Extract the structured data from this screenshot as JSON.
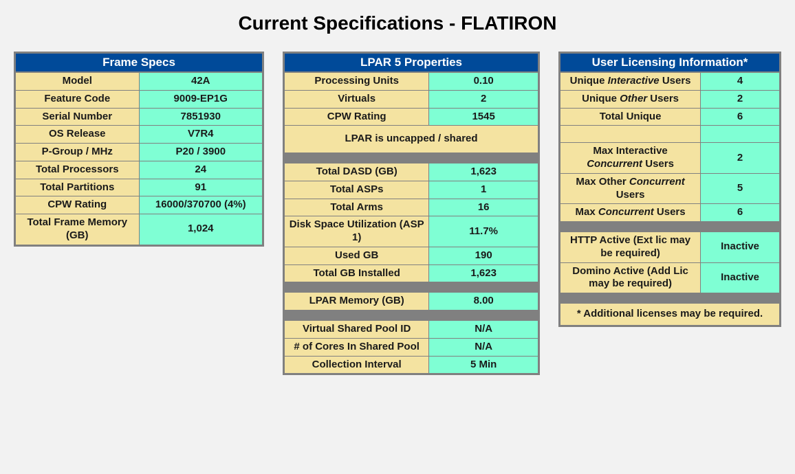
{
  "title": "Current Specifications - FLATIRON",
  "frame": {
    "header": "Frame Specs",
    "rows": [
      {
        "label": "Model",
        "value": "42A"
      },
      {
        "label": "Feature Code",
        "value": "9009-EP1G"
      },
      {
        "label": "Serial Number",
        "value": "7851930"
      },
      {
        "label": "OS Release",
        "value": "V7R4"
      },
      {
        "label": "P-Group / MHz",
        "value": "P20 / 3900"
      },
      {
        "label": "Total Processors",
        "value": "24"
      },
      {
        "label": "Total Partitions",
        "value": "91"
      },
      {
        "label": "CPW Rating",
        "value": "16000/370700 (4%)"
      },
      {
        "label": "Total Frame Memory (GB)",
        "value": "1,024"
      }
    ]
  },
  "lpar": {
    "header": "LPAR 5 Properties",
    "top": [
      {
        "label": "Processing Units",
        "value": "0.10"
      },
      {
        "label": "Virtuals",
        "value": "2"
      },
      {
        "label": "CPW Rating",
        "value": "1545"
      }
    ],
    "note": "LPAR is uncapped / shared",
    "dasd": [
      {
        "label": "Total DASD (GB)",
        "value": "1,623"
      },
      {
        "label": "Total ASPs",
        "value": "1"
      },
      {
        "label": "Total Arms",
        "value": "16"
      },
      {
        "label": "Disk Space Utilization (ASP 1)",
        "value": "11.7%"
      },
      {
        "label": "Used GB",
        "value": "190"
      },
      {
        "label": "Total GB Installed",
        "value": "1,623"
      }
    ],
    "memory": [
      {
        "label": "LPAR Memory (GB)",
        "value": "8.00"
      }
    ],
    "pool": [
      {
        "label": "Virtual Shared Pool ID",
        "value": "N/A"
      },
      {
        "label": "# of Cores In Shared Pool",
        "value": "N/A"
      },
      {
        "label": "Collection Interval",
        "value": "5 Min"
      }
    ]
  },
  "licensing": {
    "header": "User Licensing Information*",
    "unique": {
      "interactive_label_pre": "Unique ",
      "interactive_em": "Interactive",
      "interactive_post": " Users",
      "interactive_value": "4",
      "other_label_pre": "Unique ",
      "other_em": "Other",
      "other_post": " Users",
      "other_value": "2",
      "total_label": "Total Unique",
      "total_value": "6"
    },
    "concurrent": {
      "interactive_pre": "Max Interactive ",
      "interactive_em": "Concurrent",
      "interactive_post": " Users",
      "interactive_value": "2",
      "other_pre": "Max Other ",
      "other_em": "Concurrent",
      "other_post": " Users",
      "other_value": "5",
      "max_pre": "Max ",
      "max_em": "Concurrent",
      "max_post": " Users",
      "max_value": "6"
    },
    "active": {
      "http_label": "HTTP Active (Ext lic may be required)",
      "http_value": "Inactive",
      "domino_label": "Domino Active (Add Lic may be required)",
      "domino_value": "Inactive"
    },
    "footnote": "* Additional licenses may be required."
  }
}
